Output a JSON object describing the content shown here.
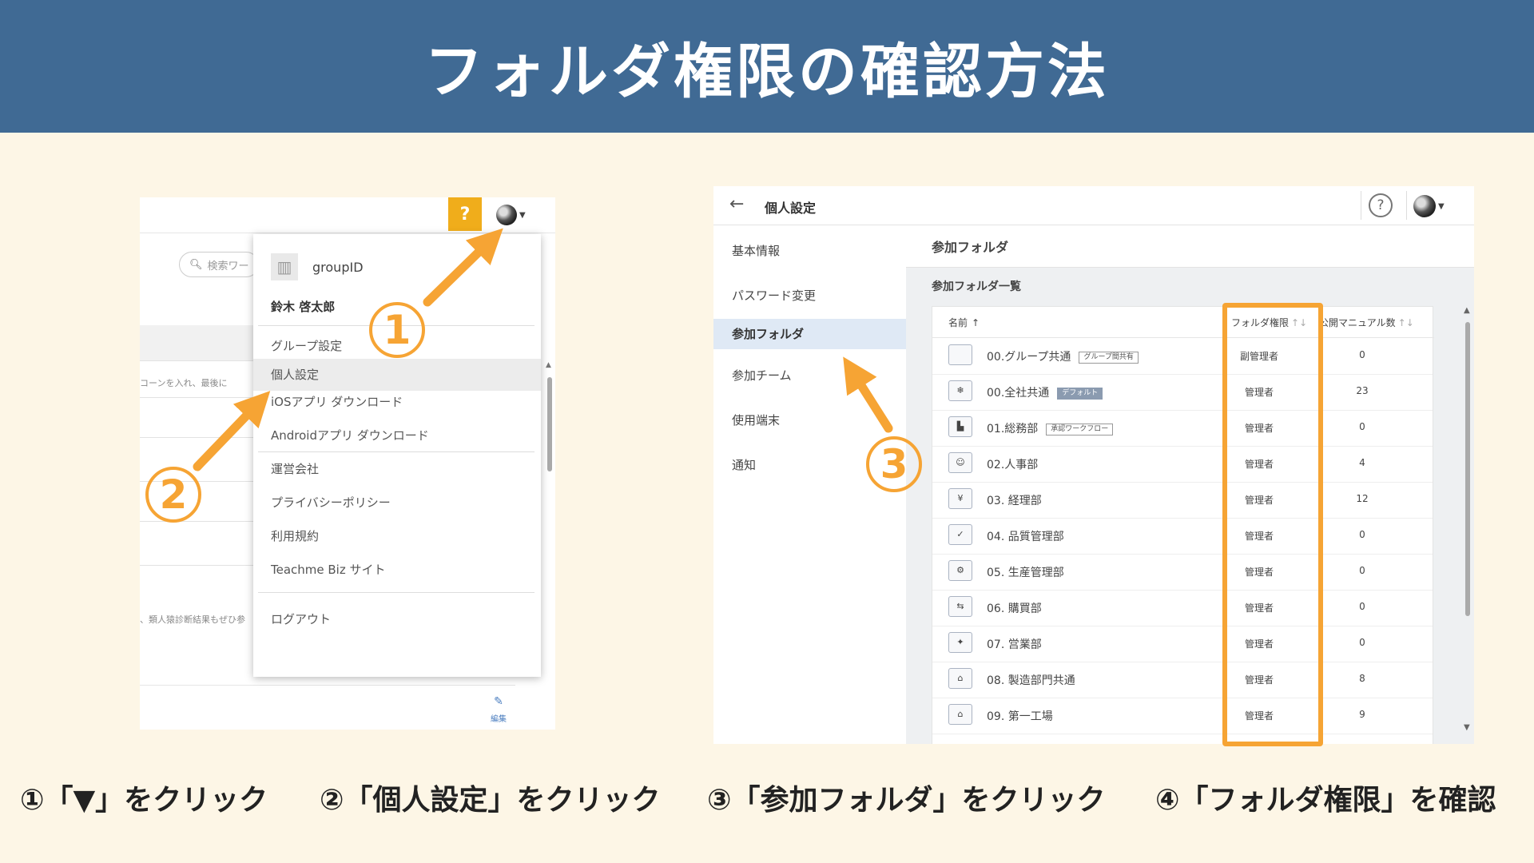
{
  "title": "フォルダ権限の確認方法",
  "colors": {
    "header_bg": "#406a94",
    "accent_orange": "#f6a434",
    "help_yellow": "#f0ad1b",
    "page_bg": "#fdf6e6"
  },
  "left_screen": {
    "help_label": "?",
    "search_placeholder": "検索ワー",
    "bg_text_1": "コーンを入れ、最後に",
    "bg_text_2": "、類人猿診断結果もぜひ参",
    "edit_label": "編集",
    "menu": {
      "group_id": "groupID",
      "user_name": "鈴木 啓太郎",
      "items": [
        {
          "label": "グループ設定"
        },
        {
          "label": "個人設定"
        },
        {
          "label": "iOSアプリ ダウンロード"
        },
        {
          "label": "Androidアプリ ダウンロード"
        },
        {
          "label": "運営会社"
        },
        {
          "label": "プライバシーポリシー"
        },
        {
          "label": "利用規約"
        },
        {
          "label": "Teachme Biz サイト"
        },
        {
          "label": "ログアウト"
        }
      ]
    }
  },
  "right_screen": {
    "page_title": "個人設定",
    "help_label": "?",
    "sidebar": [
      {
        "label": "基本情報"
      },
      {
        "label": "パスワード変更"
      },
      {
        "label": "参加フォルダ"
      },
      {
        "label": "参加チーム"
      },
      {
        "label": "使用端末"
      },
      {
        "label": "通知"
      }
    ],
    "section_title": "参加フォルダ",
    "list_title": "参加フォルダ一覧",
    "columns": {
      "name": "名前",
      "permission": "フォルダ権限",
      "manuals": "公開マニュアル数"
    },
    "rows": [
      {
        "name": "00.グループ共通",
        "tag": "グループ間共有",
        "tag_style": "outline",
        "icon": "folder-icon",
        "permission": "副管理者",
        "count": "0"
      },
      {
        "name": "00.全社共通",
        "tag": "デフォルト",
        "tag_style": "filled",
        "icon": "snowflake-folder-icon",
        "permission": "管理者",
        "count": "23"
      },
      {
        "name": "01.総務部",
        "tag": "承認ワークフロー",
        "tag_style": "outline",
        "icon": "building-folder-icon",
        "permission": "管理者",
        "count": "0"
      },
      {
        "name": "02.人事部",
        "tag": "",
        "tag_style": "",
        "icon": "people-folder-icon",
        "permission": "管理者",
        "count": "4"
      },
      {
        "name": "03. 経理部",
        "tag": "",
        "tag_style": "",
        "icon": "money-folder-icon",
        "permission": "管理者",
        "count": "12"
      },
      {
        "name": "04. 品質管理部",
        "tag": "",
        "tag_style": "",
        "icon": "check-folder-icon",
        "permission": "管理者",
        "count": "0"
      },
      {
        "name": "05. 生産管理部",
        "tag": "",
        "tag_style": "",
        "icon": "gear-folder-icon",
        "permission": "管理者",
        "count": "0"
      },
      {
        "name": "06. 購買部",
        "tag": "",
        "tag_style": "",
        "icon": "cart-folder-icon",
        "permission": "管理者",
        "count": "0"
      },
      {
        "name": "07. 営業部",
        "tag": "",
        "tag_style": "",
        "icon": "handshake-folder-icon",
        "permission": "管理者",
        "count": "0"
      },
      {
        "name": "08. 製造部門共通",
        "tag": "",
        "tag_style": "",
        "icon": "factory-folder-icon",
        "permission": "管理者",
        "count": "8"
      },
      {
        "name": "09. 第一工場",
        "tag": "",
        "tag_style": "",
        "icon": "factory-folder-icon",
        "permission": "管理者",
        "count": "9"
      }
    ]
  },
  "markers": {
    "one": "1",
    "two": "2",
    "three": "3"
  },
  "steps": [
    "①「▼」をクリック",
    "②「個人設定」をクリック",
    "③「参加フォルダ」をクリック",
    "④「フォルダ権限」を確認"
  ]
}
